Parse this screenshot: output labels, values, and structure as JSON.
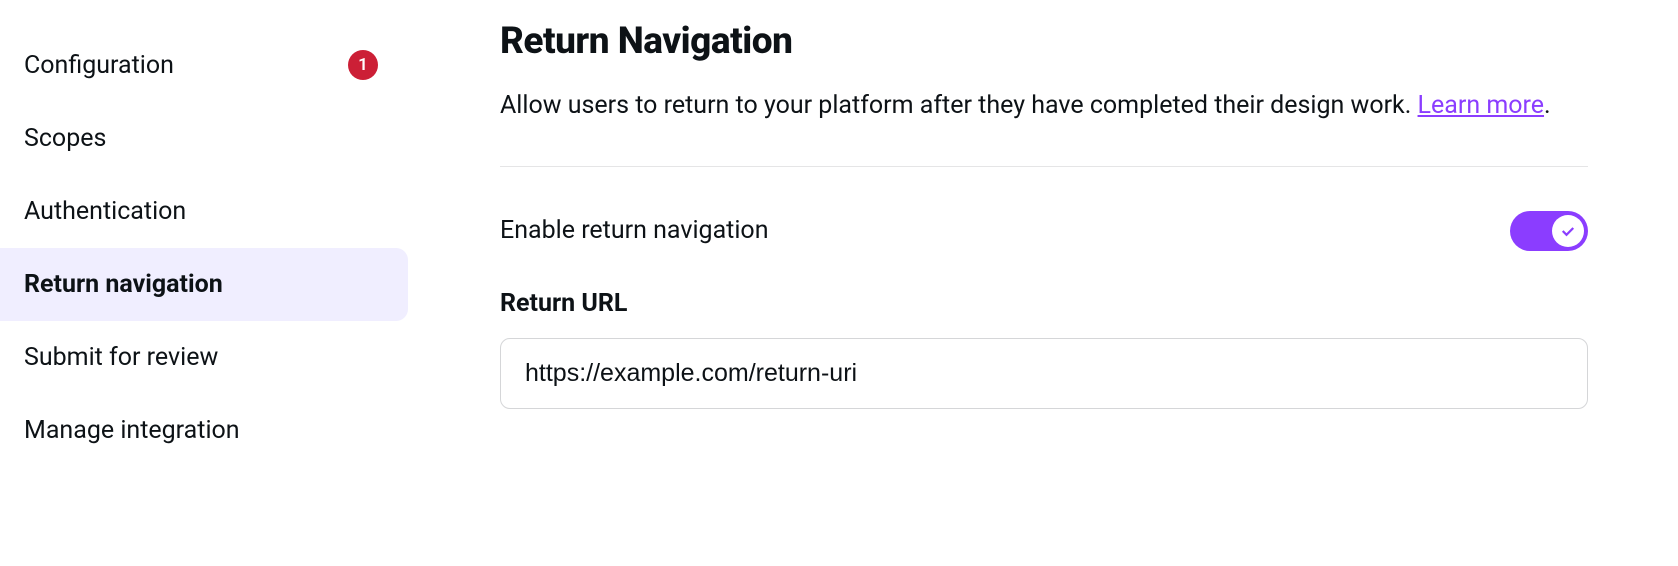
{
  "sidebar": {
    "items": [
      {
        "label": "Configuration",
        "badge": "1",
        "active": false
      },
      {
        "label": "Scopes",
        "badge": null,
        "active": false
      },
      {
        "label": "Authentication",
        "badge": null,
        "active": false
      },
      {
        "label": "Return navigation",
        "badge": null,
        "active": true
      },
      {
        "label": "Submit for review",
        "badge": null,
        "active": false
      },
      {
        "label": "Manage integration",
        "badge": null,
        "active": false
      }
    ]
  },
  "main": {
    "title": "Return Navigation",
    "description_pre": "Allow users to return to your platform after they have completed their design work. ",
    "learn_more": "Learn more",
    "description_post": ".",
    "toggle_label": "Enable return navigation",
    "toggle_on": true,
    "return_url_label": "Return URL",
    "return_url_value": "https://example.com/return-uri"
  },
  "colors": {
    "accent": "#8b3dff",
    "badge_bg": "#cc1f36",
    "active_bg": "#f0eeff"
  }
}
